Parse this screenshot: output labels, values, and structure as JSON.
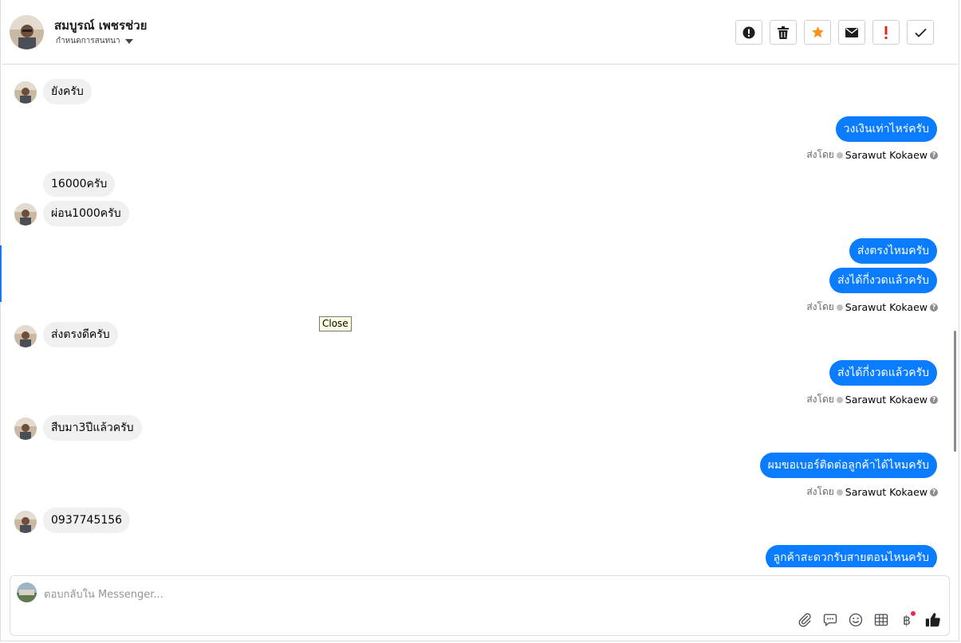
{
  "header": {
    "contact_name": "สมบูรณ์ เพชรช่วย",
    "subtitle": "กำหนดการสนทนา",
    "toolbar": [
      {
        "name": "spam-button",
        "icon": "alert-circle-icon"
      },
      {
        "name": "delete-button",
        "icon": "trash-icon"
      },
      {
        "name": "star-button",
        "icon": "star-icon",
        "color": "#f7931e"
      },
      {
        "name": "mark-unread-button",
        "icon": "envelope-icon"
      },
      {
        "name": "follow-up-button",
        "icon": "exclamation-icon",
        "color": "#e4231b"
      },
      {
        "name": "mark-done-button",
        "icon": "check-icon"
      }
    ]
  },
  "sent_label": "ส่งโดย",
  "agent_name": "Sarawut Kokaew",
  "messages": [
    {
      "dir": "in",
      "text": "ยังครับ"
    },
    {
      "dir": "out",
      "text": "วงเงินเท่าไหร่ครับ"
    },
    {
      "dir": "in",
      "text": "16000ครับ"
    },
    {
      "dir": "in",
      "text": "ผ่อน1000ครับ"
    },
    {
      "dir": "out",
      "text": "ส่งตรงไหมครับ"
    },
    {
      "dir": "out",
      "text": "ส่งได้กี่งวดแล้วครับ"
    },
    {
      "dir": "in",
      "text": "ส่งตรงดีครับ"
    },
    {
      "dir": "out",
      "text": "ส่งได้กี่งวดแล้วครับ"
    },
    {
      "dir": "in",
      "text": "สืบมา3ปีแล้วครับ"
    },
    {
      "dir": "out",
      "text": "ผมขอเบอร์ติดต่อลูกค้าได้ไหมครับ"
    },
    {
      "dir": "in",
      "text": "0937745156"
    },
    {
      "dir": "out",
      "text": "ลูกค้าสะดวกรับสายตอนไหนครับ"
    }
  ],
  "tooltip": "Close",
  "composer": {
    "placeholder": "ตอบกลับใน Messenger...",
    "value": "",
    "currency_symbol": "฿",
    "icons": [
      "paperclip-icon",
      "saved-reply-icon",
      "emoji-icon",
      "table-icon",
      "baht-icon",
      "thumbs-up-icon"
    ]
  },
  "colors": {
    "accent": "#1877f2",
    "outgoing_bubble": "#0a7cff",
    "incoming_bubble": "#f0f0f0"
  }
}
